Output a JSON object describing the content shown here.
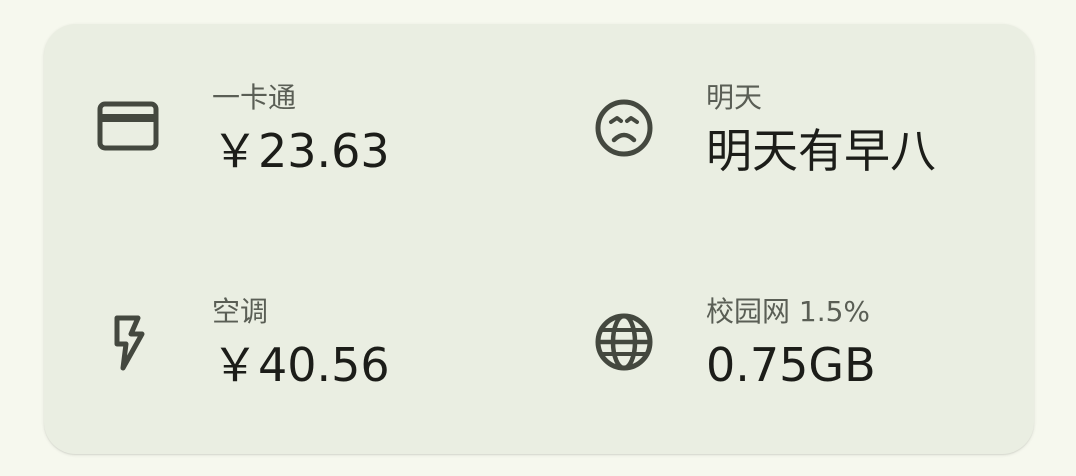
{
  "tiles": {
    "card": {
      "label": "一卡通",
      "value": "￥23.63",
      "icon": "credit-card-icon"
    },
    "tomorrow": {
      "label": "明天",
      "value": "明天有早八",
      "icon": "sad-face-icon"
    },
    "ac": {
      "label": "空调",
      "value": "￥40.56",
      "icon": "lightning-bolt-icon"
    },
    "net": {
      "label": "校园网 1.5%",
      "value": "0.75GB",
      "icon": "globe-icon"
    }
  },
  "colors": {
    "background": "#f6f8ee",
    "card": "#eaeee2",
    "icon": "#44483f",
    "label": "#5a5e55",
    "value": "#1c1d19"
  }
}
